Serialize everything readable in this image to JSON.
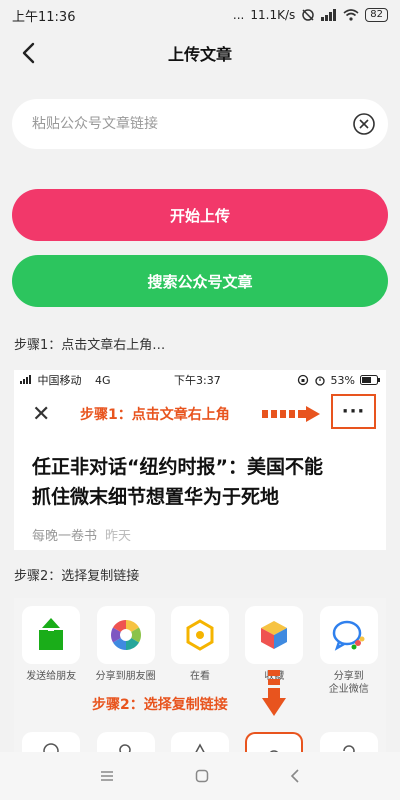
{
  "status_bar": {
    "time": "上午11:36",
    "dots": "...",
    "speed": "11.1K/s",
    "battery": "82"
  },
  "nav": {
    "title": "上传文章"
  },
  "link_input": {
    "placeholder": "粘贴公众号文章链接",
    "value": ""
  },
  "buttons": {
    "upload": "开始上传",
    "search": "搜索公众号文章"
  },
  "step1": {
    "title": "步骤1：点击文章右上角…",
    "phone_status": {
      "carrier": "中国移动",
      "network": "4G",
      "time": "下午3:37",
      "battery": "53%"
    },
    "close_symbol": "✕",
    "hint": "步骤1：点击文章右上角",
    "more_symbol": "···",
    "headline_line1": "任正非对话“纽约时报”：美国不能",
    "headline_line2": "抓住微末细节想置华为于死地",
    "source": "每晚一卷书",
    "date": "昨天"
  },
  "step2": {
    "title": "步骤2：选择复制链接",
    "hint": "步骤2：选择复制链接",
    "share_items": [
      {
        "label": "发送给朋友",
        "icon": "send-to-friend-icon"
      },
      {
        "label": "分享到朋友圈",
        "icon": "moments-icon"
      },
      {
        "label": "在看",
        "icon": "wow-icon"
      },
      {
        "label": "收藏",
        "icon": "favorite-icon"
      },
      {
        "label": "分享到\n企业微信",
        "icon": "wecom-icon"
      }
    ]
  },
  "colors": {
    "accent_pink": "#f2386a",
    "accent_green": "#2cc55e",
    "annotation_orange": "#e8541e"
  }
}
